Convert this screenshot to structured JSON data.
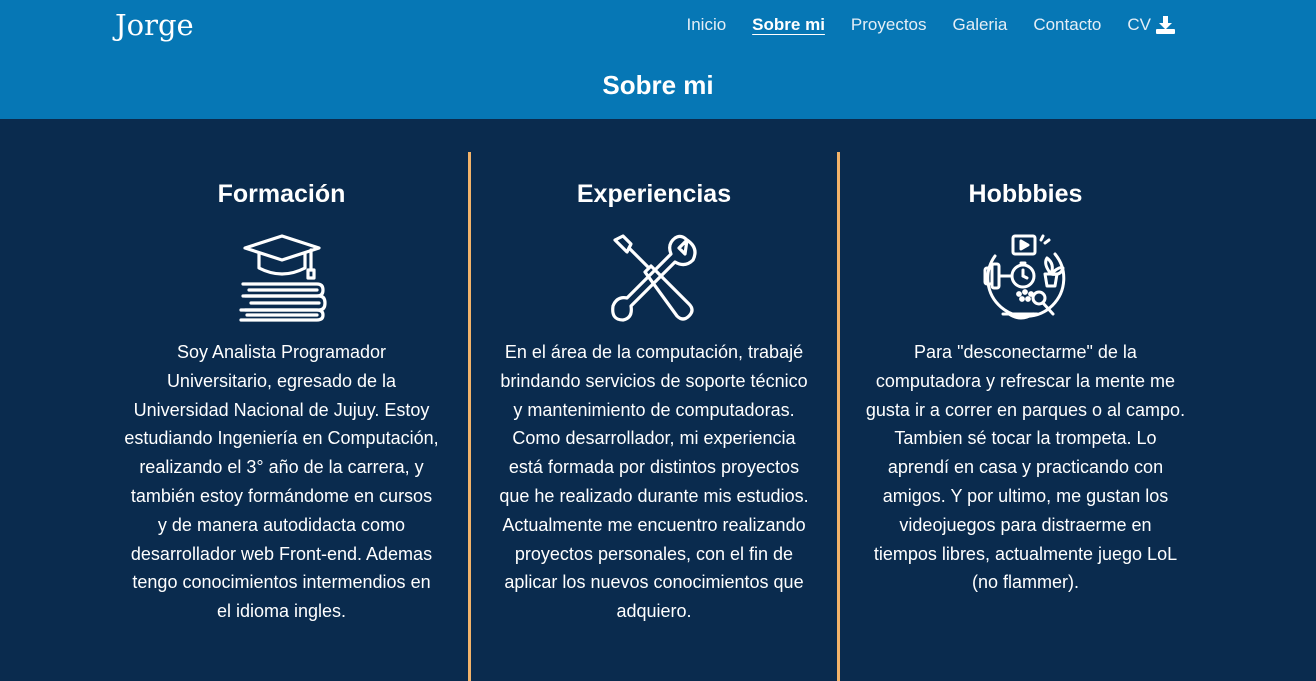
{
  "header": {
    "brand": "Jorge",
    "nav": [
      {
        "label": "Inicio",
        "active": false
      },
      {
        "label": "Sobre mi",
        "active": true
      },
      {
        "label": "Proyectos",
        "active": false
      },
      {
        "label": "Galeria",
        "active": false
      },
      {
        "label": "Contacto",
        "active": false
      },
      {
        "label": "CV",
        "active": false,
        "icon": "download-icon"
      }
    ],
    "page_title": "Sobre mi"
  },
  "columns": [
    {
      "title": "Formación",
      "icon": "graduation-cap-books-icon",
      "text": "Soy Analista Programador Universitario, egresado de la Universidad Nacional de Jujuy. Estoy estudiando Ingeniería en Computación, realizando el 3° año de la carrera, y también estoy formándome en cursos y de manera autodidacta como desarrollador web Front-end. Ademas tengo conocimientos intermendios en el idioma ingles."
    },
    {
      "title": "Experiencias",
      "icon": "tools-icon",
      "text": "En el área de la computación, trabajé brindando servicios de soporte técnico y mantenimiento de computadoras. Como desarrollador, mi experiencia está formada por distintos proyectos que he realizado durante mis estudios. Actualmente me encuentro realizando proyectos personales, con el fin de aplicar los nuevos conocimientos que adquiero."
    },
    {
      "title": "Hobbbies",
      "icon": "hobbies-icon",
      "text": "Para \"desconectarme\" de la computadora y refrescar la mente me gusta ir a correr en parques o al campo. Tambien sé tocar la trompeta. Lo aprendí en casa y practicando con amigos. Y por ultimo, me gustan los videojuegos para distraerme en tiempos libres, actualmente juego LoL (no flammer)."
    }
  ],
  "colors": {
    "header_bg": "#0677b5",
    "body_bg": "#0a2b4e",
    "divider": "#f2b36a"
  }
}
